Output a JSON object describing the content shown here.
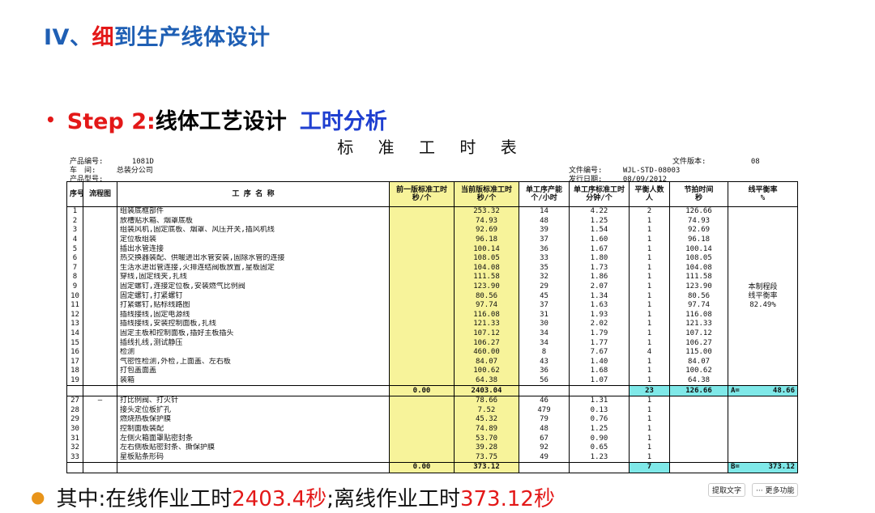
{
  "title": {
    "prefix": "IV、",
    "highlight": "细",
    "rest": "到生产线体设计"
  },
  "step": {
    "bullet": "•",
    "label": "Step 2:",
    "text": "线体工艺设计",
    "tag": "工时分析"
  },
  "sheet": {
    "title": "标 准 工 时 表",
    "meta": {
      "product_no_label": "产品编号:",
      "product_no": "1081D",
      "workshop_label": "车　间:",
      "workshop": "总装分公司",
      "model_label": "产品型号:",
      "version_label": "文件版本:",
      "version": "08",
      "docno_label": "文件编号:",
      "docno": "WJL-STD-08003",
      "date_label": "发行日期:",
      "date": "08/09/2012"
    },
    "headers": {
      "seq": "序号",
      "flow": "流程图",
      "proc": "工 序 名 称",
      "prev": "前一版标准工时\n秒/个",
      "cur": "当前版标准工时\n秒/个",
      "cap": "单工序产能\n个/小时",
      "std": "单工序标准工时\n分钟/个",
      "people": "平衡人数\n人",
      "beat": "节拍时间\n秒",
      "balance": "线平衡率\n%"
    },
    "rows": [
      {
        "no": "1",
        "name": "组装底框部件",
        "cur": "253.32",
        "cap": "14",
        "std": "4.22",
        "ppl": "2",
        "beat": "126.66"
      },
      {
        "no": "2",
        "name": "放槽贴水箱、烟罩底板",
        "cur": "74.93",
        "cap": "48",
        "std": "1.25",
        "ppl": "1",
        "beat": "74.93"
      },
      {
        "no": "3",
        "name": "组装风机,固定底板、烟罩、风压开关,插风机线",
        "cur": "92.69",
        "cap": "39",
        "std": "1.54",
        "ppl": "1",
        "beat": "92.69"
      },
      {
        "no": "4",
        "name": "定位板组装",
        "cur": "96.18",
        "cap": "37",
        "std": "1.60",
        "ppl": "1",
        "beat": "96.18"
      },
      {
        "no": "5",
        "name": "插出水管连接",
        "cur": "100.14",
        "cap": "36",
        "std": "1.67",
        "ppl": "1",
        "beat": "100.14"
      },
      {
        "no": "6",
        "name": "热交换器装配、供暖进出水管安装,固除水管的连接",
        "cur": "108.05",
        "cap": "33",
        "std": "1.80",
        "ppl": "1",
        "beat": "108.05"
      },
      {
        "no": "7",
        "name": "生活水进出管连接,火排连结阀板放置,星板固定",
        "cur": "104.08",
        "cap": "35",
        "std": "1.73",
        "ppl": "1",
        "beat": "104.08"
      },
      {
        "no": "8",
        "name": "穿线,固定线夹,扎线",
        "cur": "111.58",
        "cap": "32",
        "std": "1.86",
        "ppl": "1",
        "beat": "111.58"
      },
      {
        "no": "9",
        "name": "固定螺钉,连接定位板,安装燃气比例阀",
        "cur": "123.90",
        "cap": "29",
        "std": "2.07",
        "ppl": "1",
        "beat": "123.90"
      },
      {
        "no": "10",
        "name": "固定螺钉,打紧螺钉",
        "cur": "80.56",
        "cap": "45",
        "std": "1.34",
        "ppl": "1",
        "beat": "80.56"
      },
      {
        "no": "11",
        "name": "打紧螺钉,贴标线路图",
        "cur": "97.74",
        "cap": "37",
        "std": "1.63",
        "ppl": "1",
        "beat": "97.74"
      },
      {
        "no": "12",
        "name": "插线接线,固定电源线",
        "cur": "116.08",
        "cap": "31",
        "std": "1.93",
        "ppl": "1",
        "beat": "116.08"
      },
      {
        "no": "13",
        "name": "插线接线,安装控制面板,扎线",
        "cur": "121.33",
        "cap": "30",
        "std": "2.02",
        "ppl": "1",
        "beat": "121.33"
      },
      {
        "no": "14",
        "name": "固定主板和控制面板,插好主板插头",
        "cur": "107.12",
        "cap": "34",
        "std": "1.79",
        "ppl": "1",
        "beat": "107.12"
      },
      {
        "no": "15",
        "name": "插线扎线,测试静压",
        "cur": "106.27",
        "cap": "34",
        "std": "1.77",
        "ppl": "1",
        "beat": "106.27"
      },
      {
        "no": "16",
        "name": "检测",
        "cur": "460.00",
        "cap": "8",
        "std": "7.67",
        "ppl": "4",
        "beat": "115.00"
      },
      {
        "no": "17",
        "name": "气密性检测,外检,上面盖、左右板",
        "cur": "84.07",
        "cap": "43",
        "std": "1.40",
        "ppl": "1",
        "beat": "84.07"
      },
      {
        "no": "18",
        "name": "打包盖面盖",
        "cur": "100.62",
        "cap": "36",
        "std": "1.68",
        "ppl": "1",
        "beat": "100.62"
      },
      {
        "no": "19",
        "name": "装箱",
        "cur": "64.38",
        "cap": "56",
        "std": "1.07",
        "ppl": "1",
        "beat": "64.38"
      }
    ],
    "sum1": {
      "prev": "0.00",
      "cur": "2403.04",
      "ppl": "23",
      "beat": "126.66",
      "bal": "A=",
      "bal_val": "48.66"
    },
    "balance_note": [
      "本制程段",
      "线平衡率",
      "82.49%"
    ],
    "flow_mark": "—",
    "rows2": [
      {
        "no": "27",
        "name": "打比例阀、打火针",
        "cur": "78.66",
        "cap": "46",
        "std": "1.31",
        "ppl": "1"
      },
      {
        "no": "28",
        "name": "接头定位板扩孔",
        "cur": "7.52",
        "cap": "479",
        "std": "0.13",
        "ppl": "1"
      },
      {
        "no": "29",
        "name": "燃烧热板保护膜",
        "cur": "45.32",
        "cap": "79",
        "std": "0.76",
        "ppl": "1"
      },
      {
        "no": "30",
        "name": "控制面板装配",
        "cur": "74.89",
        "cap": "48",
        "std": "1.25",
        "ppl": "1"
      },
      {
        "no": "31",
        "name": "左侧火箱面罩贴密封条",
        "cur": "53.70",
        "cap": "67",
        "std": "0.90",
        "ppl": "1"
      },
      {
        "no": "32",
        "name": "左右侧板贴密封条、撕保护膜",
        "cur": "39.28",
        "cap": "92",
        "std": "0.65",
        "ppl": "1"
      },
      {
        "no": "33",
        "name": "星板贴条形码",
        "cur": "73.75",
        "cap": "49",
        "std": "1.23",
        "ppl": "1"
      }
    ],
    "sum2": {
      "prev": "0.00",
      "cur": "373.12",
      "ppl": "7",
      "bal": "B=",
      "bal_val": "373.12"
    }
  },
  "bottom": {
    "a": "其中:在线作业工时",
    "b": "2403.4秒",
    "c": ";离线作业工时",
    "d": "373.12秒"
  },
  "tools": {
    "extract": "提取文字",
    "more": "··· 更多功能"
  }
}
